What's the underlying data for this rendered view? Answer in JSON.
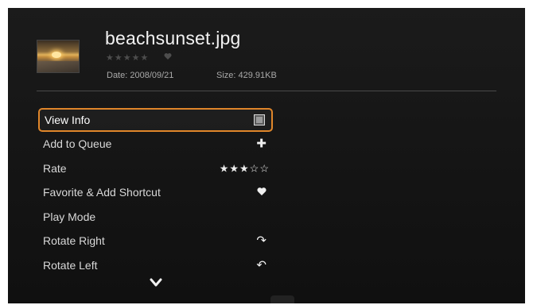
{
  "file": {
    "name": "beachsunset.jpg",
    "rating_stars": "★★★★★",
    "date_text": "Date: 2008/09/21",
    "size_text": "Size: 429.91KB"
  },
  "menu": {
    "items": [
      {
        "label": "View Info",
        "icon": "info-box-icon",
        "selected": true
      },
      {
        "label": "Add to Queue",
        "icon": "plus-icon",
        "glyph": "✚"
      },
      {
        "label": "Rate",
        "icon": "rating-stars-icon",
        "glyph": "★★★☆☆",
        "rating": 3
      },
      {
        "label": "Favorite & Add Shortcut",
        "icon": "heart-icon"
      },
      {
        "label": "Play Mode",
        "icon": ""
      },
      {
        "label": "Rotate Right",
        "icon": "rotate-right-icon",
        "glyph": "↷"
      },
      {
        "label": "Rotate Left",
        "icon": "rotate-left-icon",
        "glyph": "↶"
      }
    ]
  },
  "colors": {
    "accent": "#e0862a",
    "background": "#161616",
    "text": "#d8d8d8"
  }
}
